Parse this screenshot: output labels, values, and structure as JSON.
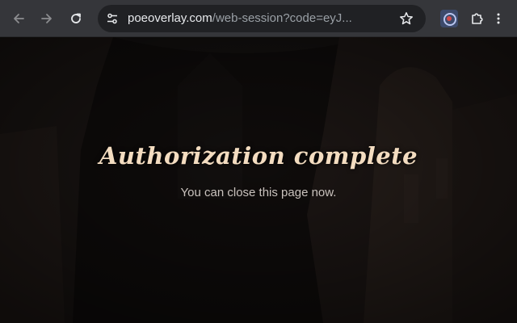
{
  "browser": {
    "url_domain": "poeoverlay.com",
    "url_path": "/web-session?code=eyJ...",
    "icons": {
      "back": "back-arrow-icon",
      "forward": "forward-arrow-icon",
      "reload": "reload-icon",
      "site_info": "tune-icon",
      "bookmark": "star-icon",
      "extension": "extension-app-icon",
      "extensions_menu": "puzzle-icon",
      "menu": "kebab-menu-icon"
    }
  },
  "page": {
    "heading": "Authorization complete",
    "message": "You can close this page now."
  },
  "colors": {
    "toolbar": "#35363a",
    "omnibox": "#202124",
    "heading": "#f3dcc0",
    "message": "#c9c2bd",
    "background": "#0e0b0a"
  }
}
